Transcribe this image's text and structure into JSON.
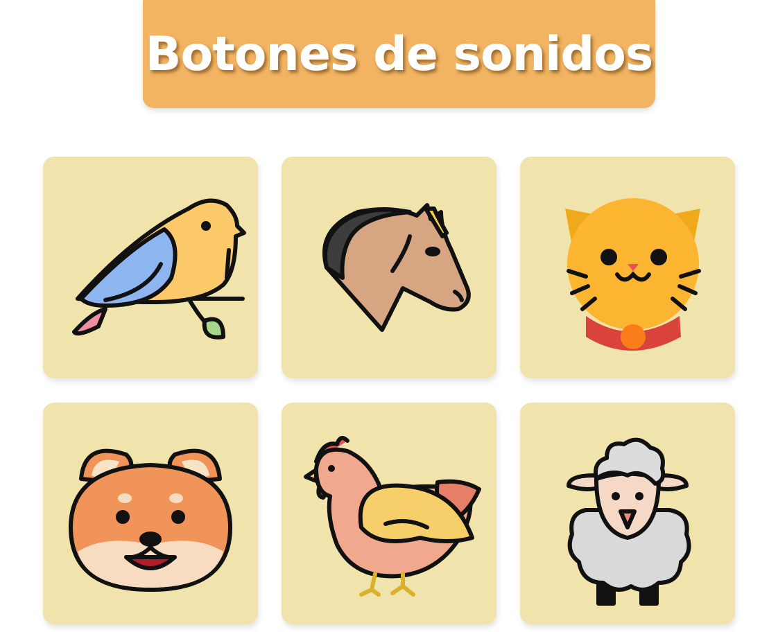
{
  "header": {
    "title": "Botones de sonidos"
  },
  "buttons": [
    {
      "animal": "bird",
      "icon": "bird-icon"
    },
    {
      "animal": "horse",
      "icon": "horse-icon"
    },
    {
      "animal": "cat",
      "icon": "cat-icon"
    },
    {
      "animal": "dog",
      "icon": "dog-icon"
    },
    {
      "animal": "chicken",
      "icon": "chicken-icon"
    },
    {
      "animal": "sheep",
      "icon": "sheep-icon"
    }
  ],
  "colors": {
    "title_bg": "#f2b462",
    "card_bg": "#f1e3ac",
    "outline": "#111111"
  }
}
